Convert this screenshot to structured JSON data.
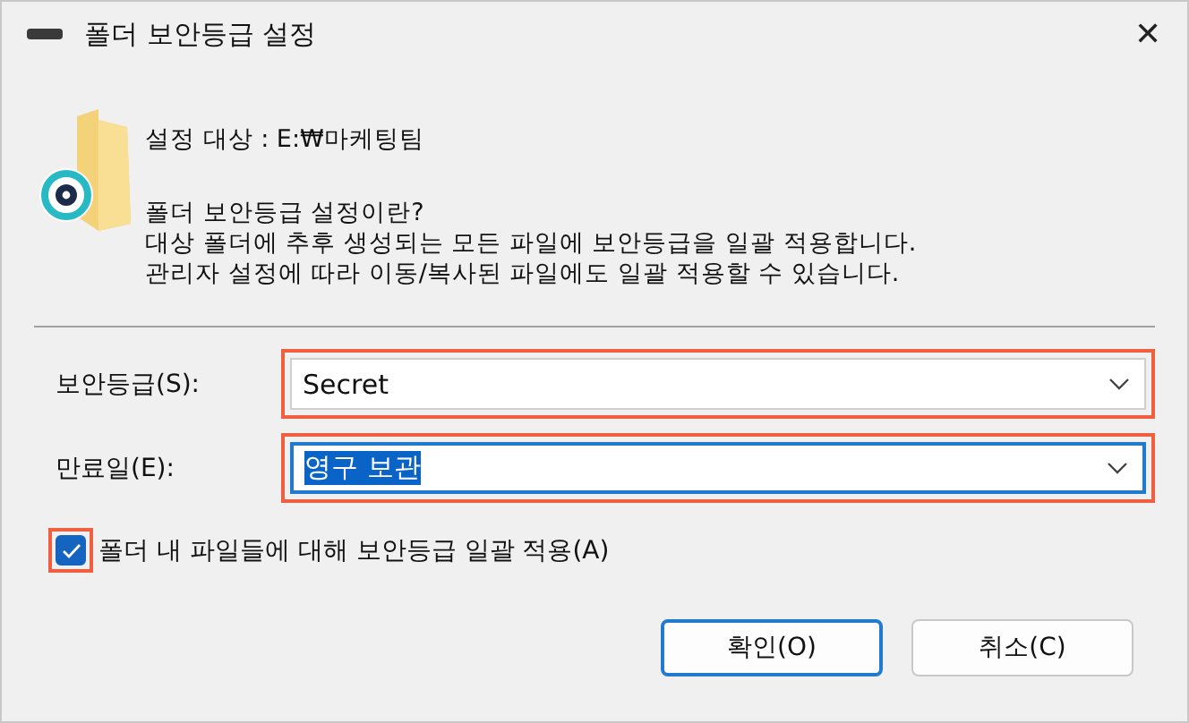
{
  "window": {
    "title": "폴더 보안등급 설정",
    "close": "✕"
  },
  "target": "설정 대상 : E:₩마케팅팀",
  "info": {
    "heading": "폴더 보안등급 설정이란?",
    "lines": [
      "대상 폴더에 추후 생성되는 모든 파일에 보안등급을 일괄 적용합니다.",
      "관리자 설정에 따라 이동/복사된 파일에도 일괄 적용할 수 있습니다."
    ]
  },
  "fields": [
    {
      "label": "보안등급(S):",
      "value": "Secret",
      "focused": false,
      "text_selected": false,
      "highlighted": true
    },
    {
      "label": "만료일(E):",
      "value": "영구 보관",
      "focused": true,
      "text_selected": true,
      "highlighted": true
    }
  ],
  "checkbox": {
    "label": "폴더 내 파일들에 대해 보안등급 일괄 적용(A)",
    "checked": true,
    "highlighted": true
  },
  "buttons": [
    {
      "label": "확인(O)",
      "default": true
    },
    {
      "label": "취소(C)",
      "default": false
    }
  ]
}
